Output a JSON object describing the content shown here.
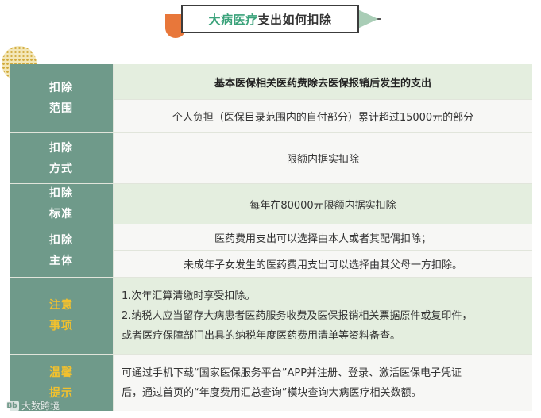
{
  "header": {
    "title_highlight": "大病医疗",
    "title_rest": "支出如何扣除"
  },
  "table": {
    "rows": [
      {
        "label": [
          "扣除",
          "范围"
        ],
        "lines": [
          "基本医保相关医药费除去医保报销后发生的支出",
          "个人负担（医保目录范围内的自付部分）累计超过15000元的部分"
        ]
      },
      {
        "label": [
          "扣除",
          "方式"
        ],
        "lines": [
          "限额内据实扣除"
        ]
      },
      {
        "label": [
          "扣除",
          "标准"
        ],
        "lines": [
          "每年在80000元限额内据实扣除"
        ]
      },
      {
        "label": [
          "扣除",
          "主体"
        ],
        "lines": [
          "医药费用支出可以选择由本人或者其配偶扣除；",
          "未成年子女发生的医药费用支出可以选择由其父母一方扣除。"
        ]
      },
      {
        "label": [
          "注意",
          "事项"
        ],
        "lines": [
          "1.次年汇算清缴时享受扣除。",
          "2.纳税人应当留存大病患者医药服务收费及医保报销相关票据原件或复印件，",
          "或者医疗保障部门出具的纳税年度医药费用清单等资料备查。"
        ]
      },
      {
        "label": [
          "温馨",
          "提示"
        ],
        "lines": [
          "可通过手机下载“国家医保服务平台”APP并注册、登录、激活医保电子凭证",
          "后，通过首页的“年度费用汇总查询”模块查询大病医疗相关数额。"
        ]
      }
    ]
  },
  "watermark": {
    "logo": "Bb",
    "text": "大数跨境"
  },
  "colors": {
    "label_bg": "#6f9a8a",
    "label_gold": "#f2c12e",
    "row_green": "#e4eedf",
    "row_white": "#f7f7f5",
    "accent_green": "#3aa27a",
    "accent_orange": "#e8773a"
  }
}
